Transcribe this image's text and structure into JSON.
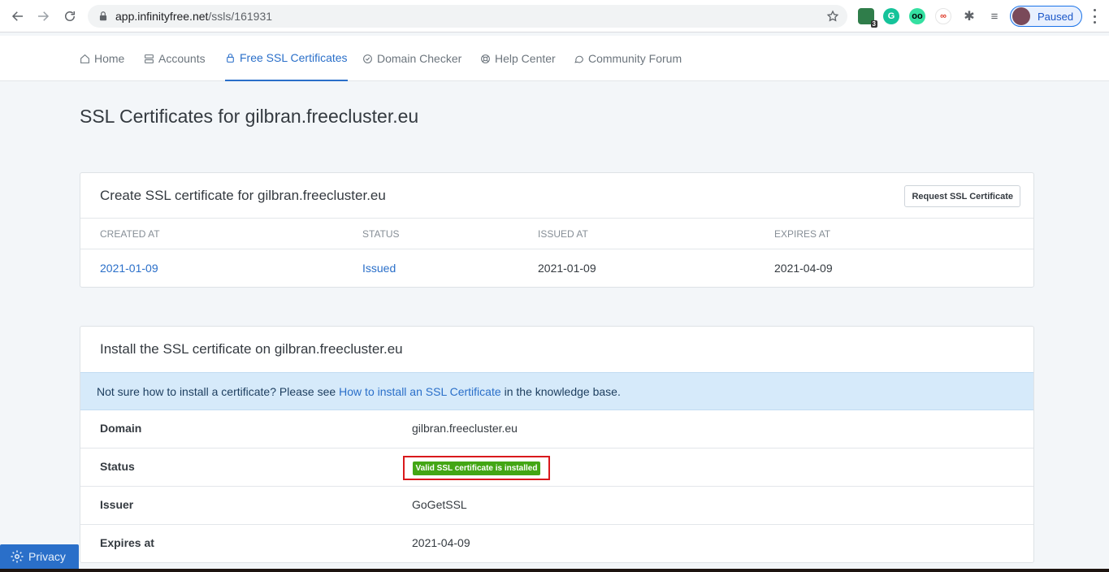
{
  "browser": {
    "url_host": "app.infinityfree.net",
    "url_path": "/ssls/161931",
    "extension_badge": "3",
    "profile_label": "Paused"
  },
  "nav": {
    "items": [
      {
        "label": "Home",
        "icon": "home-icon"
      },
      {
        "label": "Accounts",
        "icon": "server-icon"
      },
      {
        "label": "Free SSL Certificates",
        "icon": "lock-icon",
        "active": true
      },
      {
        "label": "Domain Checker",
        "icon": "check-circle-icon"
      },
      {
        "label": "Help Center",
        "icon": "lifebuoy-icon"
      },
      {
        "label": "Community Forum",
        "icon": "chat-bubble-icon"
      }
    ]
  },
  "page": {
    "title": "SSL Certificates for gilbran.freecluster.eu"
  },
  "create_card": {
    "title": "Create SSL certificate for gilbran.freecluster.eu",
    "request_button": "Request SSL Certificate",
    "columns": [
      "CREATED AT",
      "STATUS",
      "ISSUED AT",
      "EXPIRES AT"
    ],
    "rows": [
      {
        "created_at": "2021-01-09",
        "status": "Issued",
        "issued_at": "2021-01-09",
        "expires_at": "2021-04-09"
      }
    ]
  },
  "install_card": {
    "title": "Install the SSL certificate on gilbran.freecluster.eu",
    "alert_prefix": "Not sure how to install a certificate? Please see",
    "alert_link": "How to install an SSL Certificate",
    "alert_suffix": "in the knowledge base.",
    "domain_label": "Domain",
    "domain_value": "gilbran.freecluster.eu",
    "status_label": "Status",
    "status_badge": "Valid SSL certificate is installed",
    "issuer_label": "Issuer",
    "issuer_value": "GoGetSSL",
    "expires_label": "Expires at",
    "expires_value": "2021-04-09"
  },
  "privacy_button": "Privacy",
  "colors": {
    "accent": "#2a6fc9",
    "success": "#43a615",
    "highlight": "#d9191c"
  }
}
